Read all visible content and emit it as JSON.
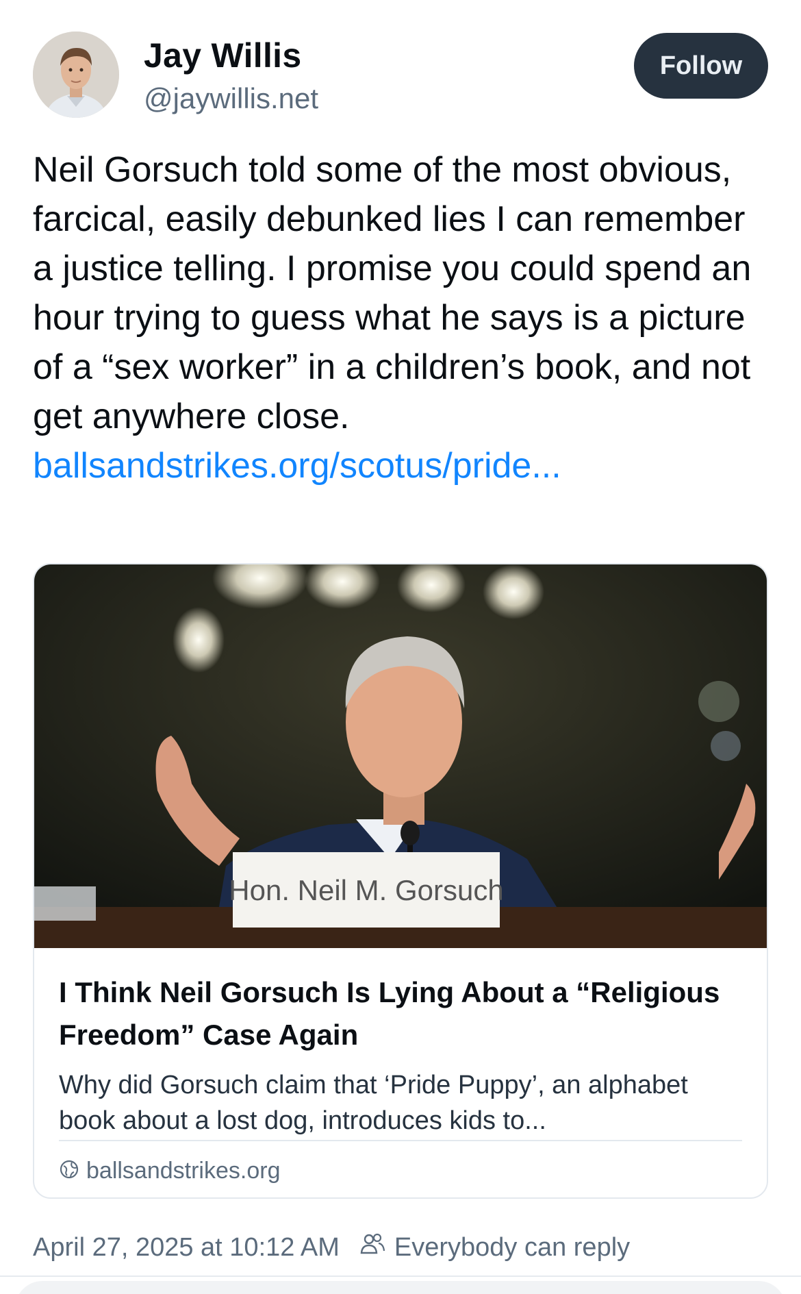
{
  "author": {
    "name": "Jay Willis",
    "handle": "@jaywillis.net"
  },
  "follow_button": "Follow",
  "post": {
    "text": "Neil Gorsuch told some of the most obvious, farcical, easily debunked lies I can remember a justice telling. I promise you could spend an hour trying to guess what he says is a picture of a “sex worker” in a children’s book, and not get anywhere close. ",
    "link_text": "ballsandstrikes.org/scotus/pride..."
  },
  "card": {
    "image_nameplate": "Hon. Neil M. Gorsuch",
    "title": "I Think Neil Gorsuch Is Lying About a “Religious Freedom” Case Again",
    "description": "Why did Gorsuch claim that ‘Pride Puppy’, an alphabet book about a lost dog, introduces kids to...",
    "domain": "ballsandstrikes.org",
    "domain_icon": "globe-icon"
  },
  "meta": {
    "timestamp": "April 27, 2025 at 10:12 AM",
    "reply_setting": "Everybody can reply",
    "reply_icon": "people-icon"
  },
  "colors": {
    "link": "#1185fe",
    "follow_bg": "#26323f",
    "muted": "#5b6b7c"
  }
}
